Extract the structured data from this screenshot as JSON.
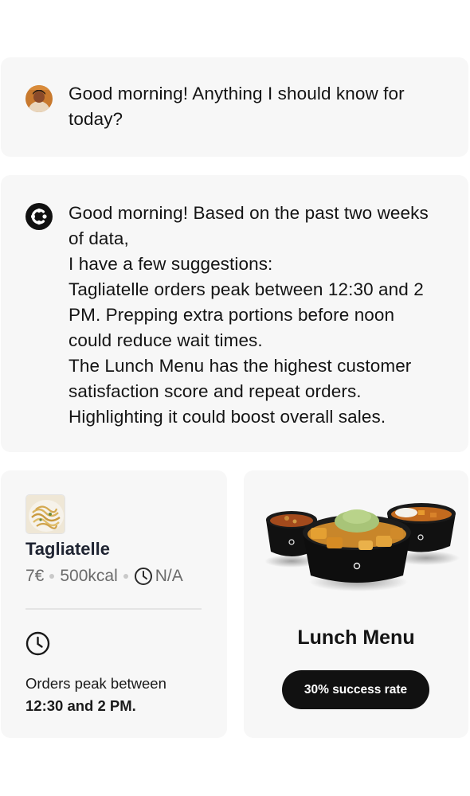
{
  "conversation": {
    "user_message": "Good morning! Anything I should know for today?",
    "assistant_lines": [
      "Good morning! Based on the past two weeks of data,",
      "I have a few suggestions:",
      "Tagliatelle orders peak between 12:30 and 2 PM. Prepping extra portions before noon could reduce wait times.",
      "The Lunch Menu has the highest customer satisfaction score and repeat orders. Highlighting it could boost overall sales."
    ],
    "user_avatar_icon": "user-avatar",
    "assistant_icon": "assistant-logo-icon"
  },
  "dish_card": {
    "name": "Tagliatelle",
    "price": "7€",
    "calories": "500kcal",
    "time": "N/A",
    "peak_label": "Orders peak between",
    "peak_value": "12:30 and 2 PM."
  },
  "menu_card": {
    "title": "Lunch Menu",
    "badge": "30% success rate"
  },
  "colors": {
    "card_background": "#f7f7f7",
    "pill_background": "#111111",
    "title_text": "#1f2432",
    "meta_text": "#6b6b6b"
  }
}
